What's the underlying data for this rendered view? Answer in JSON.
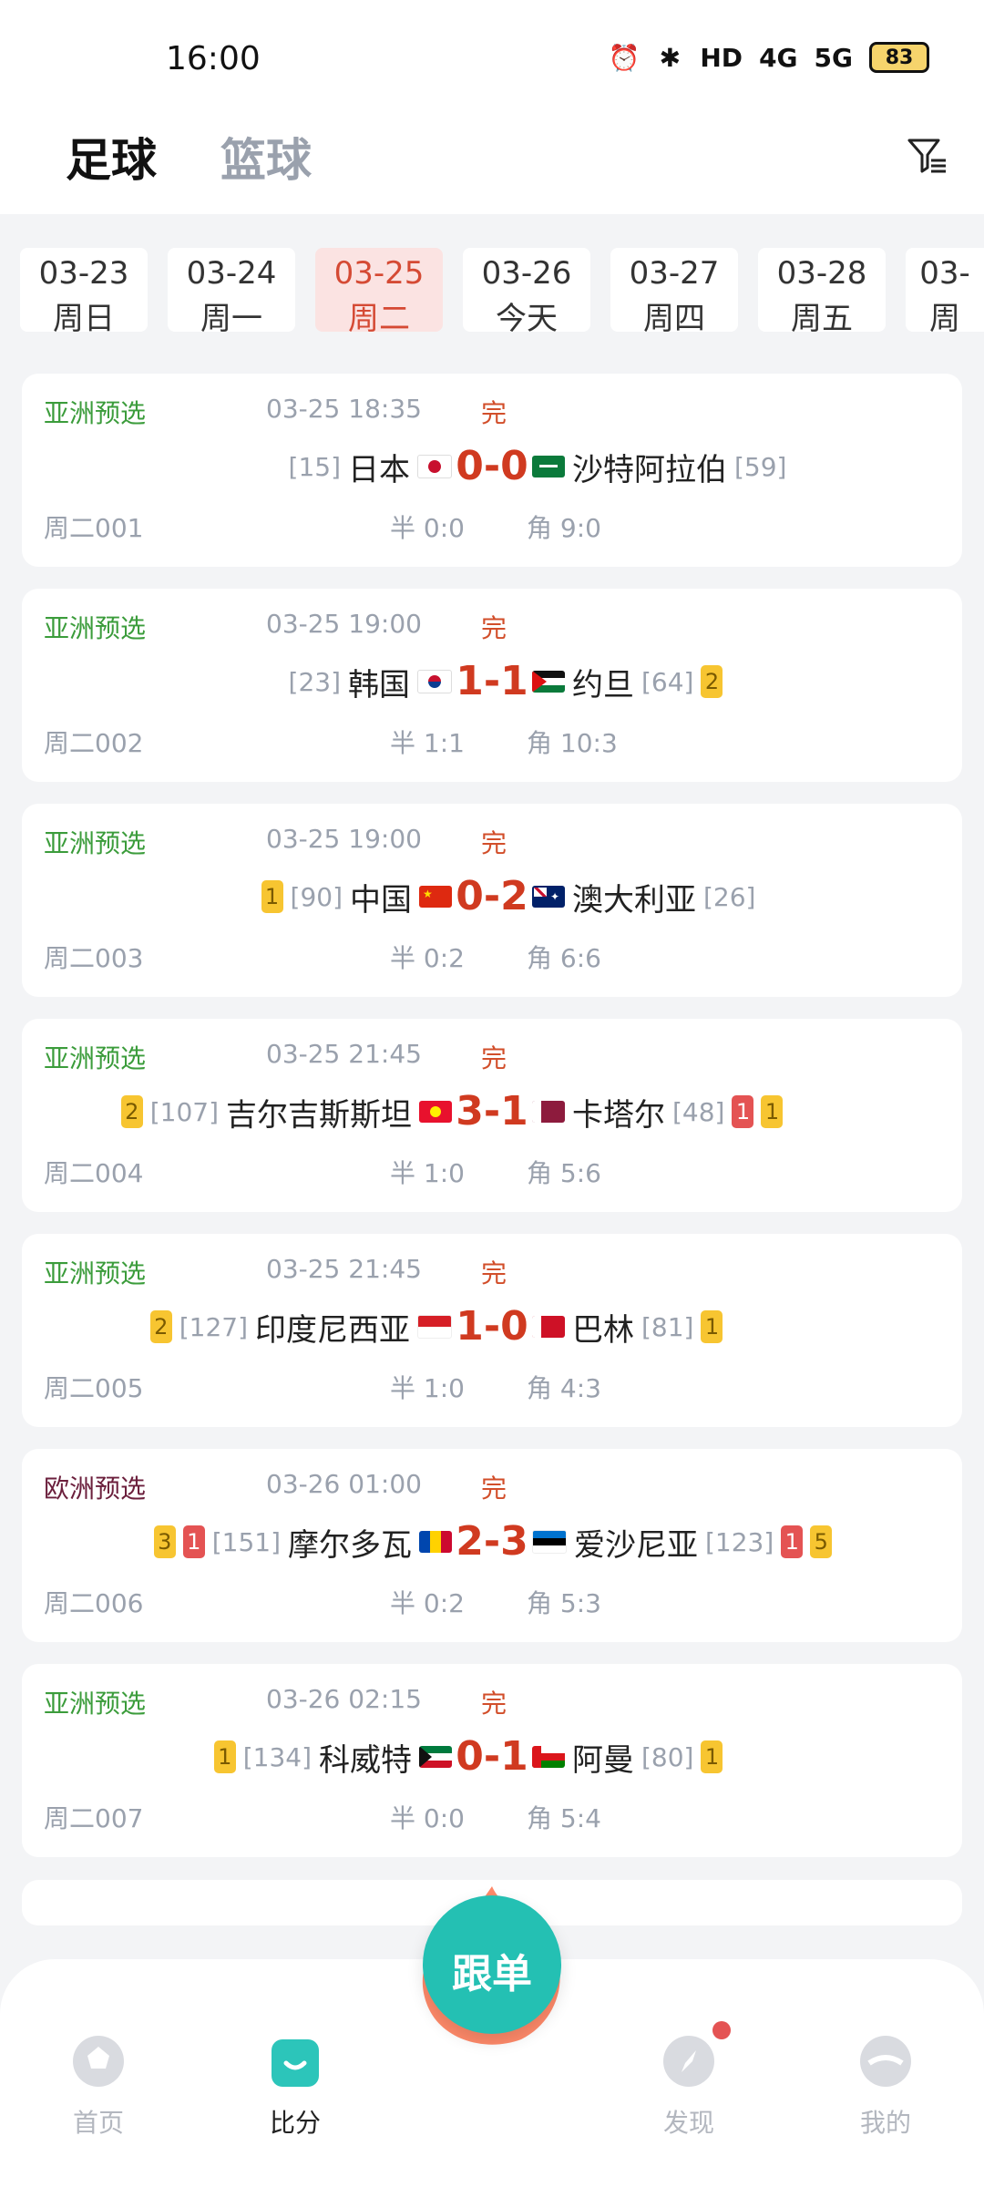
{
  "status_bar": {
    "time": "16:00",
    "icons": [
      "alarm-icon",
      "bluetooth-icon",
      "hd-icon",
      "4g-signal-icon",
      "5g-signal-icon"
    ],
    "hd_label": "HD",
    "g4_label": "4G",
    "g5_label": "5G",
    "battery": "83"
  },
  "header": {
    "tabs": [
      "足球",
      "篮球"
    ]
  },
  "dates": [
    {
      "date": "03-23",
      "weekday": "周日"
    },
    {
      "date": "03-24",
      "weekday": "周一"
    },
    {
      "date": "03-25",
      "weekday": "周二"
    },
    {
      "date": "03-26",
      "weekday": "今天"
    },
    {
      "date": "03-27",
      "weekday": "周四"
    },
    {
      "date": "03-28",
      "weekday": "周五"
    },
    {
      "date": "03-",
      "weekday": "周"
    }
  ],
  "matches": [
    {
      "league": "亚洲预选",
      "time": "03-25 18:35",
      "status": "完",
      "home_rank": "[15]",
      "home": "日本",
      "score": "0-0",
      "away": "沙特阿拉伯",
      "away_rank": "[59]",
      "code": "周二001",
      "half": "半 0:0",
      "corner": "角 9:0"
    },
    {
      "league": "亚洲预选",
      "time": "03-25 19:00",
      "status": "完",
      "home_rank": "[23]",
      "home": "韩国",
      "score": "1-1",
      "away": "约旦",
      "away_rank": "[64]",
      "away_y": "2",
      "code": "周二002",
      "half": "半 1:1",
      "corner": "角 10:3"
    },
    {
      "league": "亚洲预选",
      "time": "03-25 19:00",
      "status": "完",
      "home_y": "1",
      "home_rank": "[90]",
      "home": "中国",
      "score": "0-2",
      "away": "澳大利亚",
      "away_rank": "[26]",
      "code": "周二003",
      "half": "半 0:2",
      "corner": "角 6:6"
    },
    {
      "league": "亚洲预选",
      "time": "03-25 21:45",
      "status": "完",
      "home_y": "2",
      "home_rank": "[107]",
      "home": "吉尔吉斯斯坦",
      "score": "3-1",
      "away": "卡塔尔",
      "away_rank": "[48]",
      "away_r": "1",
      "away_y": "1",
      "code": "周二004",
      "half": "半 1:0",
      "corner": "角 5:6"
    },
    {
      "league": "亚洲预选",
      "time": "03-25 21:45",
      "status": "完",
      "home_y": "2",
      "home_rank": "[127]",
      "home": "印度尼西亚",
      "score": "1-0",
      "away": "巴林",
      "away_rank": "[81]",
      "away_y": "1",
      "code": "周二005",
      "half": "半 1:0",
      "corner": "角 4:3"
    },
    {
      "league": "欧洲预选",
      "time": "03-26 01:00",
      "status": "完",
      "home_y": "3",
      "home_r": "1",
      "home_rank": "[151]",
      "home": "摩尔多瓦",
      "score": "2-3",
      "away": "爱沙尼亚",
      "away_rank": "[123]",
      "away_r": "1",
      "away_y": "5",
      "code": "周二006",
      "half": "半 0:2",
      "corner": "角 5:3"
    },
    {
      "league": "亚洲预选",
      "time": "03-26 02:15",
      "status": "完",
      "home_y": "1",
      "home_rank": "[134]",
      "home": "科威特",
      "score": "0-1",
      "away": "阿曼",
      "away_rank": "[80]",
      "away_y": "1",
      "code": "周二007",
      "half": "半 0:0",
      "corner": "角 5:4"
    }
  ],
  "bottom_nav": {
    "items": [
      "首页",
      "比分",
      "跟单",
      "发现",
      "我的"
    ]
  }
}
